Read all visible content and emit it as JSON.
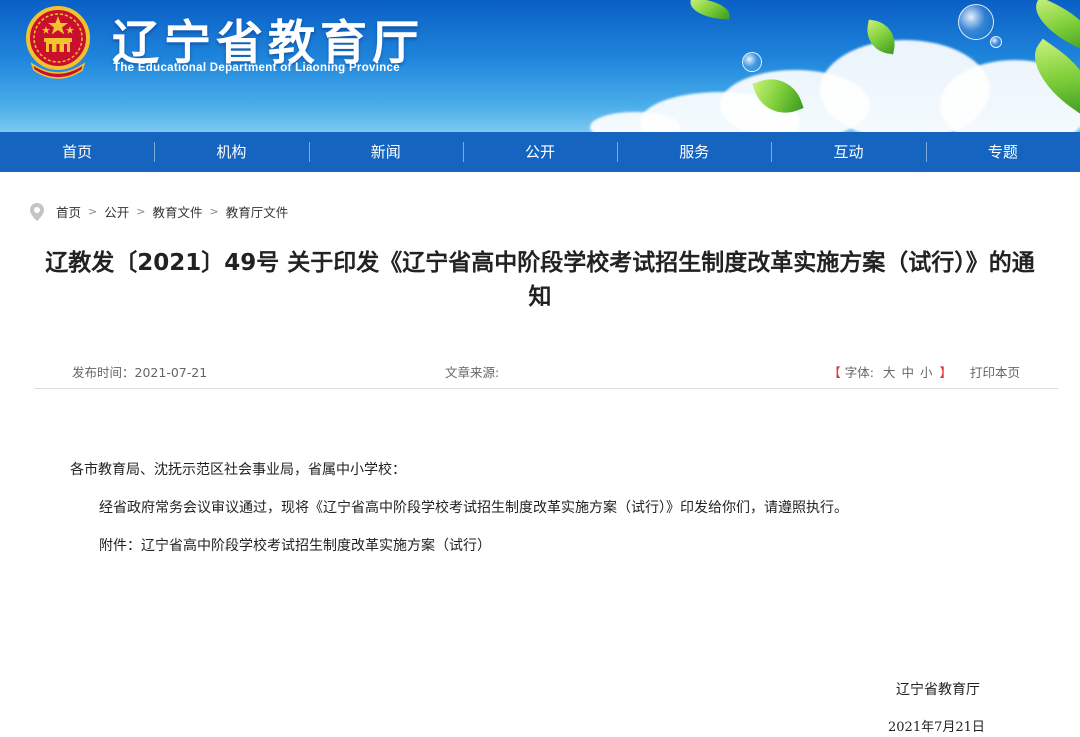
{
  "header": {
    "site_title": "辽宁省教育厅",
    "site_subtitle": "The Educational Department of Liaoning Province"
  },
  "nav": {
    "items": [
      {
        "label": "首页"
      },
      {
        "label": "机构"
      },
      {
        "label": "新闻"
      },
      {
        "label": "公开"
      },
      {
        "label": "服务"
      },
      {
        "label": "互动"
      },
      {
        "label": "专题"
      }
    ]
  },
  "breadcrumb": {
    "items": [
      "首页",
      "公开",
      "教育文件",
      "教育厅文件"
    ],
    "separator": ">"
  },
  "article": {
    "title": "辽教发〔2021〕49号 关于印发《辽宁省高中阶段学校考试招生制度改革实施方案（试行）》的通知",
    "meta": {
      "date_label": "发布时间：",
      "date_value": "2021-07-21",
      "source_label": "文章来源:",
      "font_open": "【",
      "font_label": "字体:",
      "font_large": "大",
      "font_medium": "中",
      "font_small": "小",
      "font_close": "】",
      "print_label": "打印本页"
    },
    "paragraphs": [
      "各市教育局、沈抚示范区社会事业局，省属中小学校：",
      "经省政府常务会议审议通过，现将《辽宁省高中阶段学校考试招生制度改革实施方案（试行）》印发给你们，请遵照执行。",
      "附件：辽宁省高中阶段学校考试招生制度改革实施方案（试行）"
    ],
    "signature_org": "辽宁省教育厅",
    "signature_date": "2021年7月21日"
  },
  "colors": {
    "nav_bg": "#1565c0",
    "banner_top": "#0a5fc4",
    "banner_bottom": "#7cc8f1",
    "accent_red": "#d33333"
  }
}
